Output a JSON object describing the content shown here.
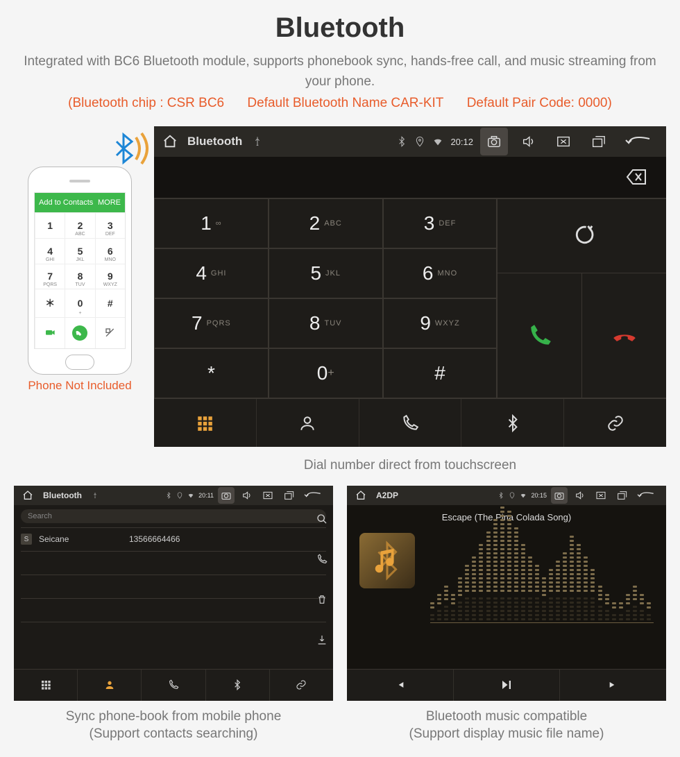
{
  "page": {
    "title": "Bluetooth",
    "subtitle": "Integrated with BC6 Bluetooth module, supports phonebook sync, hands-free call, and music streaming from your phone.",
    "spec": {
      "chip": "(Bluetooth chip : CSR BC6",
      "name": "Default Bluetooth Name CAR-KIT",
      "code": "Default Pair Code: 0000)"
    }
  },
  "captions": {
    "dial": "Dial number direct from touchscreen",
    "pb1": "Sync phone-book from mobile phone",
    "pb2": "(Support contacts searching)",
    "mz1": "Bluetooth music compatible",
    "mz2": "(Support display music file name)",
    "phone_note": "Phone Not Included"
  },
  "status": {
    "dial_title": "Bluetooth",
    "pb_title": "Bluetooth",
    "a2_title": "A2DP",
    "time_dial": "20:12",
    "time_pb": "20:11",
    "time_a2": "20:15"
  },
  "keypad": [
    {
      "n": "1",
      "s": "∞"
    },
    {
      "n": "2",
      "s": "ABC"
    },
    {
      "n": "3",
      "s": "DEF"
    },
    {
      "n": "4",
      "s": "GHI"
    },
    {
      "n": "5",
      "s": "JKL"
    },
    {
      "n": "6",
      "s": "MNO"
    },
    {
      "n": "7",
      "s": "PQRS"
    },
    {
      "n": "8",
      "s": "TUV"
    },
    {
      "n": "9",
      "s": "WXYZ"
    },
    {
      "n": "*",
      "s": ""
    },
    {
      "n": "0",
      "s": "+"
    },
    {
      "n": "#",
      "s": ""
    }
  ],
  "phone_app": {
    "header": "Add to Contacts",
    "more": "MORE",
    "keys": [
      {
        "n": "1",
        "s": ""
      },
      {
        "n": "2",
        "s": "ABC"
      },
      {
        "n": "3",
        "s": "DEF"
      },
      {
        "n": "4",
        "s": "GHI"
      },
      {
        "n": "5",
        "s": "JKL"
      },
      {
        "n": "6",
        "s": "MNO"
      },
      {
        "n": "7",
        "s": "PQRS"
      },
      {
        "n": "8",
        "s": "TUV"
      },
      {
        "n": "9",
        "s": "WXYZ"
      },
      {
        "n": "＊",
        "s": ""
      },
      {
        "n": "0",
        "s": "+"
      },
      {
        "n": "#",
        "s": ""
      }
    ]
  },
  "pb": {
    "search": "Search",
    "rows": [
      {
        "tag": "S",
        "nm": "Seicane",
        "num": "13566664466"
      }
    ]
  },
  "a2dp": {
    "track": "Escape (The Pina Colada Song)"
  },
  "colors": {
    "accent": "#e9a23b"
  }
}
